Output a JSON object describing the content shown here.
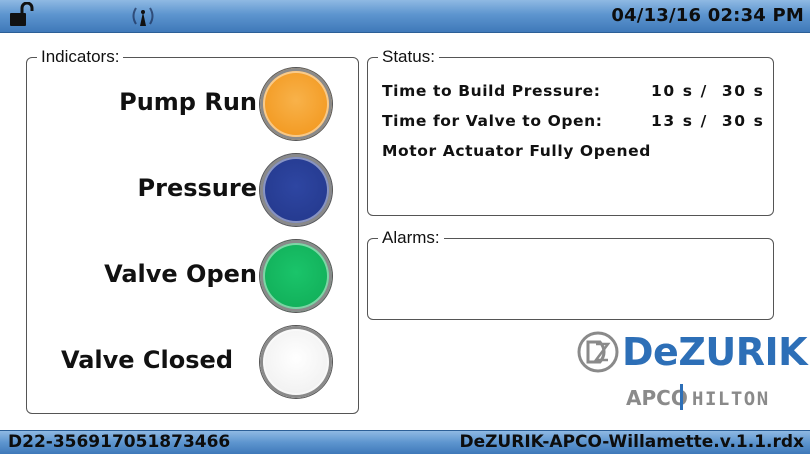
{
  "header": {
    "datetime": "04/13/16 02:34 PM",
    "lock_icon": "unlocked-padlock-icon",
    "signal_icon": "wireless-signal-icon"
  },
  "indicators": {
    "title": "Indicators:",
    "items": [
      {
        "label": "Pump Run",
        "color": "#f4a030",
        "state": "on"
      },
      {
        "label": "Pressure",
        "color": "#253a8f",
        "state": "on"
      },
      {
        "label": "Valve Open",
        "color": "#12b05a",
        "state": "on"
      },
      {
        "label": "Valve Closed",
        "color": "#f2f2f2",
        "state": "off"
      }
    ]
  },
  "status": {
    "title": "Status:",
    "lines": [
      {
        "label": "Time to Build Pressure:",
        "value": "10 s /  30 s"
      },
      {
        "label": "Time for Valve to Open:",
        "value": "13 s /  30 s"
      },
      {
        "label": "Motor Actuator Fully Opened",
        "value": ""
      }
    ]
  },
  "alarms": {
    "title": "Alarms:",
    "items": []
  },
  "branding": {
    "logo": "DeZURIK",
    "sub_left": "APCO",
    "sub_right": "HILTON",
    "accent": "#2d6fb7"
  },
  "footer": {
    "device_id": "D22-356917051873466",
    "filename": "DeZURIK-APCO-Willamette.v.1.1.rdx"
  }
}
